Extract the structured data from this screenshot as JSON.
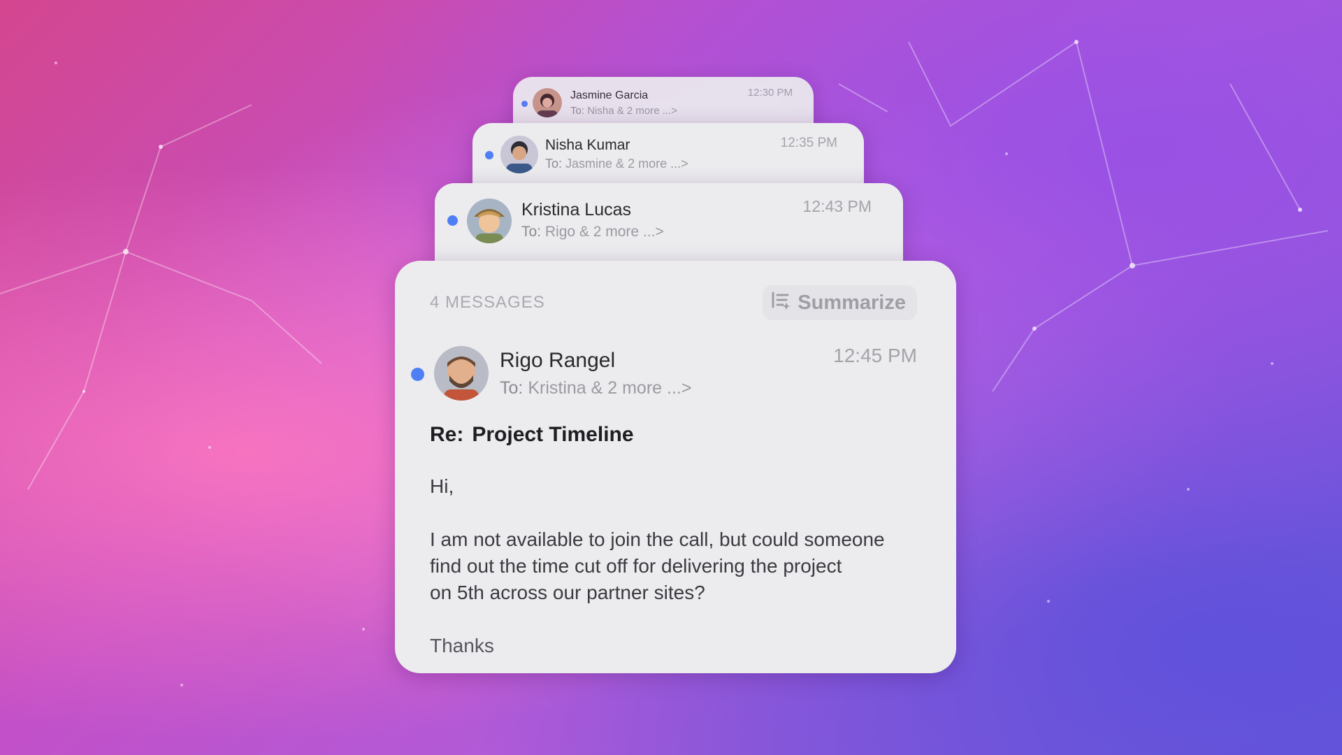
{
  "threads": [
    {
      "sender": "Jasmine Garcia",
      "recipients": "Nisha & 2 more",
      "time": "12:30 PM",
      "unread": true
    },
    {
      "sender": "Nisha Kumar",
      "recipients": "Jasmine & 2 more",
      "time": "12:35 PM",
      "unread": true
    },
    {
      "sender": "Kristina Lucas",
      "recipients": "Rigo & 2 more",
      "time": "12:43 PM",
      "unread": true
    }
  ],
  "main": {
    "message_count": "4 MESSAGES",
    "summarize_label": "Summarize",
    "sender": "Rigo Rangel",
    "to_prefix": "To:",
    "recipients": "Kristina & 2 more",
    "chevron": "...>",
    "time": "12:45 PM",
    "subject_prefix": "Re:",
    "subject": "Project Timeline",
    "greeting": "Hi,",
    "body_lines": [
      "I am not available to join the call, but could someone",
      "find out the time cut off for delivering the project",
      "on 5th across our partner sites?"
    ],
    "closing": "Thanks"
  },
  "labels": {
    "to_prefix": "To:",
    "more_chevron": "...>"
  },
  "colors": {
    "unread_dot": "#4f7ff5",
    "card_bg": "#ececef",
    "accent_pink": "#d4468f",
    "accent_purple": "#6b58d8"
  },
  "icons": {
    "summarize": "summarize-list-icon"
  }
}
